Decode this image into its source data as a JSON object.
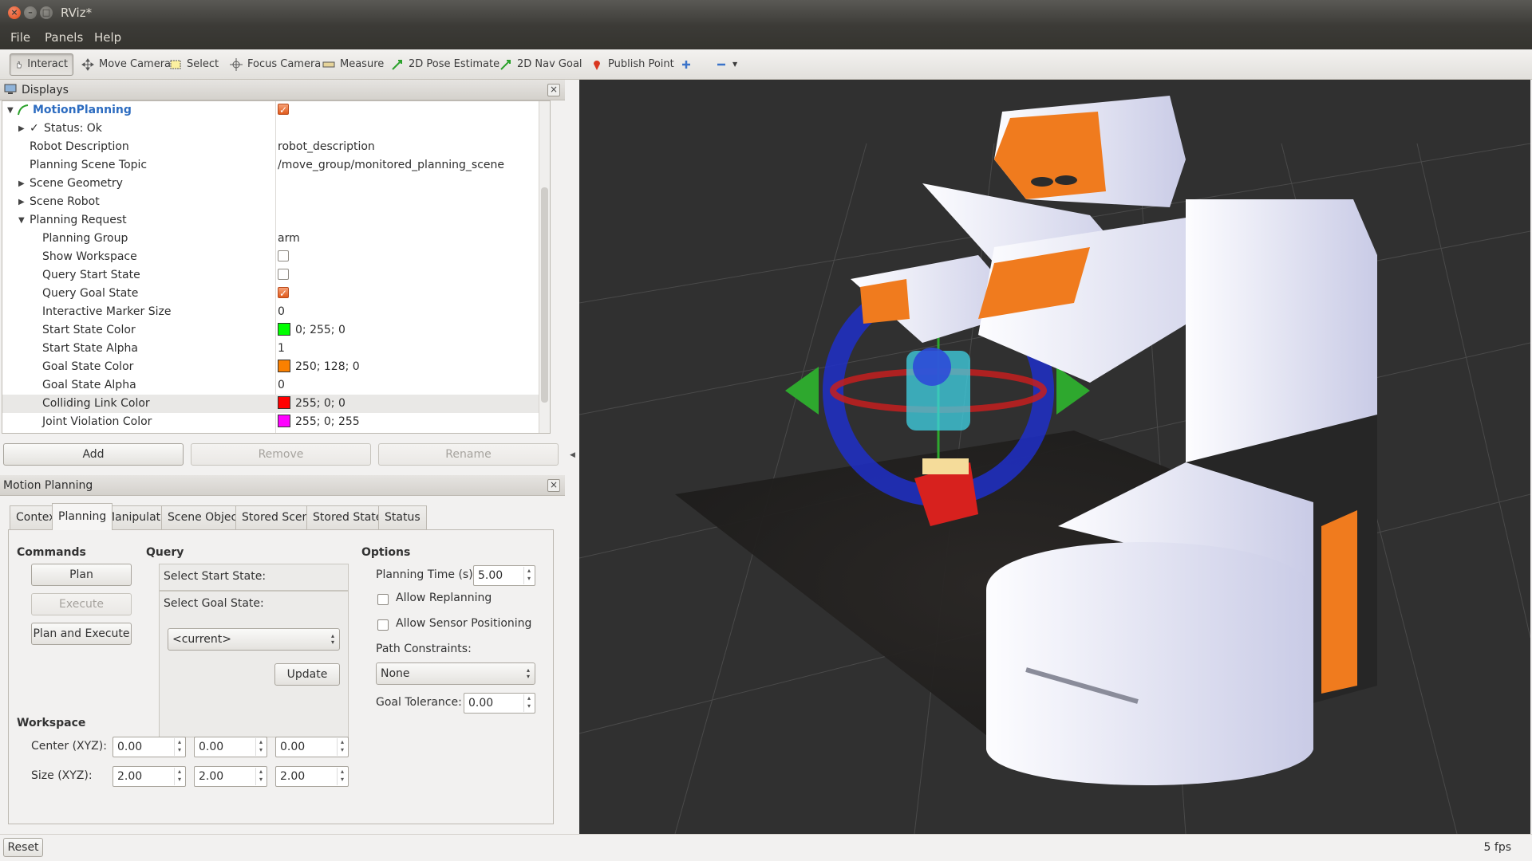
{
  "window": {
    "title": "RViz*"
  },
  "menu": {
    "file": "File",
    "panels": "Panels",
    "help": "Help"
  },
  "toolbar": {
    "interact": "Interact",
    "move_camera": "Move Camera",
    "select": "Select",
    "focus_camera": "Focus Camera",
    "measure": "Measure",
    "pose_estimate": "2D Pose Estimate",
    "nav_goal": "2D Nav Goal",
    "publish_point": "Publish Point"
  },
  "displays": {
    "title": "Displays",
    "rows": [
      {
        "label": "MotionPlanning",
        "value": "",
        "checkbox": "on"
      },
      {
        "label": "Status: Ok",
        "value": ""
      },
      {
        "label": "Robot Description",
        "value": "robot_description"
      },
      {
        "label": "Planning Scene Topic",
        "value": "/move_group/monitored_planning_scene"
      },
      {
        "label": "Scene Geometry",
        "value": ""
      },
      {
        "label": "Scene Robot",
        "value": ""
      },
      {
        "label": "Planning Request",
        "value": ""
      },
      {
        "label": "Planning Group",
        "value": "arm"
      },
      {
        "label": "Show Workspace",
        "value": "",
        "checkbox": "off"
      },
      {
        "label": "Query Start State",
        "value": "",
        "checkbox": "off"
      },
      {
        "label": "Query Goal State",
        "value": "",
        "checkbox": "on"
      },
      {
        "label": "Interactive Marker Size",
        "value": "0"
      },
      {
        "label": "Start State Color",
        "value": "0; 255; 0",
        "color": "#00ff00"
      },
      {
        "label": "Start State Alpha",
        "value": "1"
      },
      {
        "label": "Goal State Color",
        "value": "250; 128; 0",
        "color": "#fa8000"
      },
      {
        "label": "Goal State Alpha",
        "value": "0"
      },
      {
        "label": "Colliding Link Color",
        "value": "255; 0; 0",
        "color": "#ff0000"
      },
      {
        "label": "Joint Violation Color",
        "value": "255; 0; 255",
        "color": "#ff00ff"
      }
    ],
    "add": "Add",
    "remove": "Remove",
    "rename": "Rename"
  },
  "motion_planning": {
    "title": "Motion Planning",
    "tabs": [
      "Context",
      "Planning",
      "Manipulation",
      "Scene Objects",
      "Stored Scenes",
      "Stored States",
      "Status"
    ],
    "active_tab": "Planning",
    "commands": {
      "title": "Commands",
      "plan": "Plan",
      "execute": "Execute",
      "plan_execute": "Plan and Execute"
    },
    "query": {
      "title": "Query",
      "start_label": "Select Start State:",
      "goal_label": "Select Goal State:",
      "goal_value": "<current>",
      "update": "Update"
    },
    "options": {
      "title": "Options",
      "planning_time_label": "Planning Time (s):",
      "planning_time": "5.00",
      "allow_replanning": "Allow Replanning",
      "allow_sensor": "Allow Sensor Positioning",
      "path_constraints_label": "Path Constraints:",
      "path_constraints": "None",
      "goal_tolerance_label": "Goal Tolerance:",
      "goal_tolerance": "0.00"
    },
    "workspace": {
      "title": "Workspace",
      "center_label": "Center (XYZ):",
      "center": [
        "0.00",
        "0.00",
        "0.00"
      ],
      "size_label": "Size (XYZ):",
      "size": [
        "2.00",
        "2.00",
        "2.00"
      ]
    }
  },
  "status": {
    "reset": "Reset",
    "fps": "5 fps"
  },
  "colors": {
    "accent_orange": "#f07b1e",
    "viewport_bg": "#303030",
    "title_bar": "#3c3b37"
  }
}
